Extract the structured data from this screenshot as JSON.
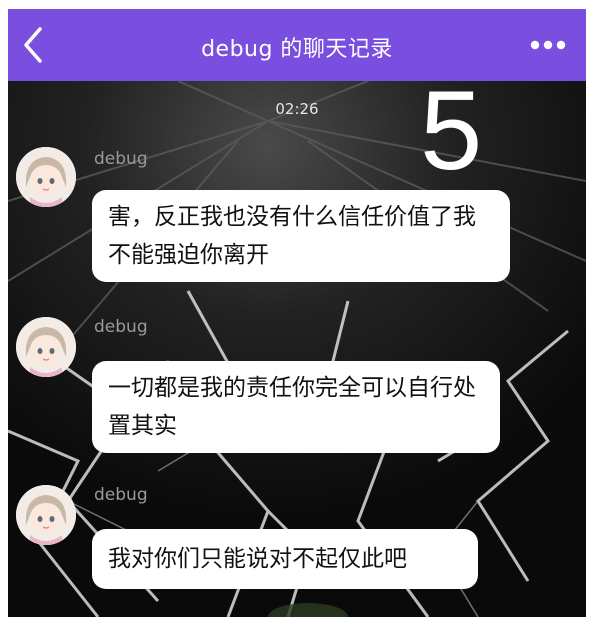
{
  "header": {
    "back_icon": "chevron-left-icon",
    "title": "debug 的聊天记录",
    "more_icon": "more-horizontal-icon"
  },
  "overlay_number": "5",
  "timestamp": "02:26",
  "messages": [
    {
      "sender": "debug",
      "text": "害，反正我也没有什么信任价值了我不能强迫你离开"
    },
    {
      "sender": "debug",
      "text": "一切都是我的责任你完全可以自行处置其实"
    },
    {
      "sender": "debug",
      "text": "我对你们只能说对不起仅此吧"
    }
  ],
  "colors": {
    "header_bg": "#7a4fe0",
    "chat_bg": "#101010",
    "bubble_bg": "#ffffff",
    "sender_text": "#9a9a9a"
  }
}
